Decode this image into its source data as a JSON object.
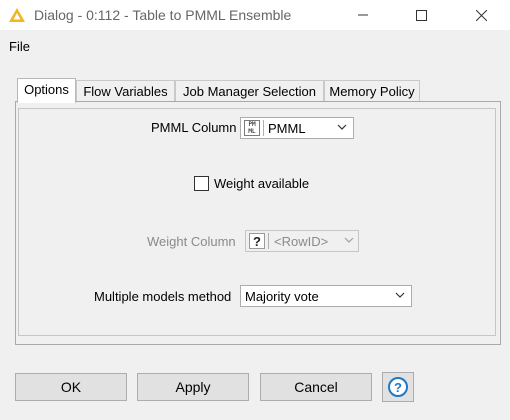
{
  "window": {
    "title": "Dialog - 0:112 - Table to PMML Ensemble",
    "app_icon": "knime-triangle-icon",
    "controls": [
      "minimize",
      "maximize",
      "close"
    ]
  },
  "menu": {
    "file": "File"
  },
  "tabs": [
    {
      "label": "Options",
      "active": true
    },
    {
      "label": "Flow Variables",
      "active": false
    },
    {
      "label": "Job Manager Selection",
      "active": false
    },
    {
      "label": "Memory Policy",
      "active": false
    }
  ],
  "options": {
    "pmml_column": {
      "label": "PMML Column",
      "value": "PMML",
      "badge": "PM\nML",
      "icon": "pmml-type-icon"
    },
    "weight_available": {
      "label": "Weight available",
      "checked": false
    },
    "weight_column": {
      "label": "Weight Column",
      "value": "<RowID>",
      "badge": "?",
      "enabled": false
    },
    "multiple_models": {
      "label": "Multiple models method",
      "value": "Majority vote"
    }
  },
  "buttons": {
    "ok": "OK",
    "apply": "Apply",
    "cancel": "Cancel",
    "help_icon": "help-question-icon"
  },
  "colors": {
    "accent": "#f2b61f",
    "help_blue": "#1e78c8",
    "disabled_text": "#8a8a8a"
  }
}
